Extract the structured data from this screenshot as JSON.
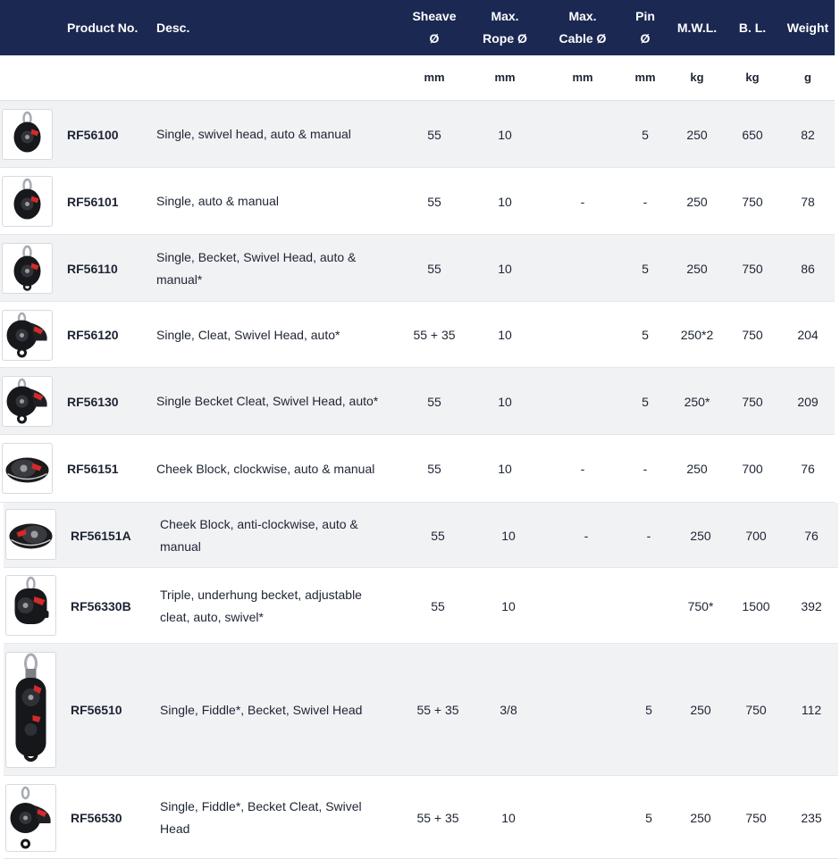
{
  "header": {
    "product_no": "Product No.",
    "desc": "Desc.",
    "sheave": [
      "Sheave",
      "Ø"
    ],
    "max_rope": [
      "Max.",
      "Rope Ø"
    ],
    "max_cable": [
      "Max.",
      "Cable Ø"
    ],
    "pin": [
      "Pin",
      "Ø"
    ],
    "mwl": "M.W.L.",
    "bl": "B. L.",
    "weight": "Weight"
  },
  "units": {
    "sheave": "mm",
    "rope": "mm",
    "cable": "mm",
    "pin": "mm",
    "mwl": "kg",
    "bl": "kg",
    "weight": "g"
  },
  "rows": [
    {
      "product_no": "RF56100",
      "desc": "Single, swivel head, auto & manual",
      "sheave": "55",
      "rope": "10",
      "cable": "",
      "pin": "5",
      "mwl": "250",
      "bl": "650",
      "weight": "82",
      "image_icon": "single-swivel-block-icon"
    },
    {
      "product_no": "RF56101",
      "desc": "Single, auto & manual",
      "sheave": "55",
      "rope": "10",
      "cable": "-",
      "pin": "-",
      "mwl": "250",
      "bl": "750",
      "weight": "78",
      "image_icon": "single-block-icon"
    },
    {
      "product_no": "RF56110",
      "desc": "Single, Becket, Swivel Head, auto & manual*",
      "sheave": "55",
      "rope": "10",
      "cable": "",
      "pin": "5",
      "mwl": "250",
      "bl": "750",
      "weight": "86",
      "image_icon": "single-becket-block-icon"
    },
    {
      "product_no": "RF56120",
      "desc": "Single, Cleat, Swivel Head, auto*",
      "sheave": "55 + 35",
      "rope": "10",
      "cable": "",
      "pin": "5",
      "mwl": "250*2",
      "bl": "750",
      "weight": "204",
      "image_icon": "cleat-block-icon"
    },
    {
      "product_no": "RF56130",
      "desc": "Single Becket Cleat, Swivel Head, auto*",
      "sheave": "55",
      "rope": "10",
      "cable": "",
      "pin": "5",
      "mwl": "250*",
      "bl": "750",
      "weight": "209",
      "image_icon": "becket-cleat-block-icon"
    },
    {
      "product_no": "RF56151",
      "desc": "Cheek Block, clockwise, auto & manual",
      "sheave": "55",
      "rope": "10",
      "cable": "-",
      "pin": "-",
      "mwl": "250",
      "bl": "700",
      "weight": "76",
      "image_icon": "cheek-block-icon"
    },
    {
      "product_no": "RF56151A",
      "desc": "Cheek Block, anti-clockwise, auto & manual",
      "sheave": "55",
      "rope": "10",
      "cable": "-",
      "pin": "-",
      "mwl": "250",
      "bl": "700",
      "weight": "76",
      "image_icon": "cheek-block-anticlockwise-icon"
    },
    {
      "product_no": "RF56330B",
      "desc": "Triple, underhung becket, adjustable cleat, auto, swivel*",
      "sheave": "55",
      "rope": "10",
      "cable": "",
      "pin": "",
      "mwl": "750*",
      "bl": "1500",
      "weight": "392",
      "image_icon": "triple-block-icon"
    },
    {
      "product_no": "RF56510",
      "desc": "Single, Fiddle*, Becket, Swivel Head",
      "sheave": "55 + 35",
      "rope": "3/8",
      "cable": "",
      "pin": "5",
      "mwl": "250",
      "bl": "750",
      "weight": "112",
      "image_icon": "fiddle-block-icon"
    },
    {
      "product_no": "RF56530",
      "desc": "Single, Fiddle*, Becket Cleat, Swivel Head",
      "sheave": "55 + 35",
      "rope": "10",
      "cable": "",
      "pin": "5",
      "mwl": "250",
      "bl": "750",
      "weight": "235",
      "image_icon": "fiddle-cleat-block-icon"
    }
  ],
  "colors": {
    "header_bg": "#1a2852",
    "row_alt_bg": "#f1f2f4",
    "accent_red": "#d32a2a"
  }
}
